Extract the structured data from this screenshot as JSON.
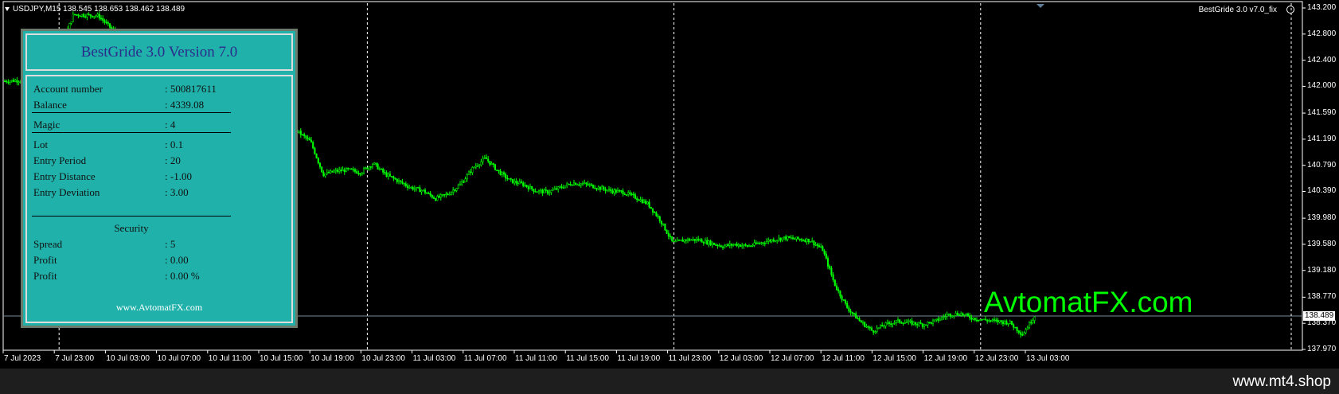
{
  "chart": {
    "symbol_line": "USDJPY,M15  138.545 138.653 138.462 138.489",
    "ea_label": "BestGride  3.0 v7.0_fix",
    "watermark": "AvtomatFX.com",
    "current_price": "138.489",
    "bull_color": "#00ff00",
    "bear_color": "#00ff00",
    "background": "#000000",
    "price_ticks": [
      "143.200",
      "142.800",
      "142.400",
      "142.000",
      "141.590",
      "141.190",
      "140.790",
      "140.390",
      "139.980",
      "139.580",
      "139.180",
      "138.770",
      "138.370",
      "137.970"
    ],
    "time_ticks": [
      "7 Jul 2023",
      "7 Jul 23:00",
      "10 Jul 03:00",
      "10 Jul 07:00",
      "10 Jul 11:00",
      "10 Jul 15:00",
      "10 Jul 19:00",
      "10 Jul 23:00",
      "11 Jul 03:00",
      "11 Jul 07:00",
      "11 Jul 11:00",
      "11 Jul 15:00",
      "11 Jul 19:00",
      "11 Jul 23:00",
      "12 Jul 03:00",
      "12 Jul 07:00",
      "12 Jul 11:00",
      "12 Jul 15:00",
      "12 Jul 19:00",
      "12 Jul 23:00",
      "13 Jul 03:00"
    ],
    "close_path": [
      [
        0,
        142.08
      ],
      [
        8,
        142.1
      ],
      [
        14,
        142.09
      ],
      [
        22,
        143.1
      ],
      [
        30,
        143.08
      ],
      [
        38,
        142.7
      ],
      [
        46,
        142.35
      ],
      [
        54,
        142.0
      ],
      [
        58,
        141.6
      ],
      [
        62,
        141.55
      ],
      [
        66,
        141.45
      ],
      [
        70,
        141.38
      ],
      [
        74,
        141.35
      ],
      [
        78,
        141.32
      ],
      [
        82,
        141.3
      ],
      [
        86,
        141.35
      ],
      [
        90,
        141.38
      ],
      [
        94,
        141.3
      ],
      [
        98,
        141.15
      ],
      [
        102,
        140.65
      ],
      [
        106,
        140.7
      ],
      [
        110,
        140.72
      ],
      [
        114,
        140.68
      ],
      [
        118,
        140.82
      ],
      [
        122,
        140.65
      ],
      [
        126,
        140.55
      ],
      [
        130,
        140.45
      ],
      [
        134,
        140.4
      ],
      [
        138,
        140.28
      ],
      [
        142,
        140.35
      ],
      [
        146,
        140.5
      ],
      [
        150,
        140.75
      ],
      [
        154,
        140.9
      ],
      [
        158,
        140.7
      ],
      [
        162,
        140.55
      ],
      [
        166,
        140.5
      ],
      [
        170,
        140.4
      ],
      [
        174,
        140.38
      ],
      [
        178,
        140.45
      ],
      [
        182,
        140.52
      ],
      [
        186,
        140.5
      ],
      [
        190,
        140.45
      ],
      [
        194,
        140.4
      ],
      [
        198,
        140.38
      ],
      [
        202,
        140.3
      ],
      [
        206,
        140.2
      ],
      [
        210,
        139.95
      ],
      [
        214,
        139.6
      ],
      [
        218,
        139.65
      ],
      [
        222,
        139.65
      ],
      [
        226,
        139.6
      ],
      [
        230,
        139.55
      ],
      [
        234,
        139.58
      ],
      [
        238,
        139.55
      ],
      [
        242,
        139.6
      ],
      [
        246,
        139.65
      ],
      [
        250,
        139.68
      ],
      [
        254,
        139.66
      ],
      [
        258,
        139.64
      ],
      [
        262,
        139.5
      ],
      [
        266,
        138.95
      ],
      [
        270,
        138.6
      ],
      [
        274,
        138.4
      ],
      [
        278,
        138.25
      ],
      [
        282,
        138.35
      ],
      [
        286,
        138.4
      ],
      [
        290,
        138.38
      ],
      [
        294,
        138.35
      ],
      [
        298,
        138.4
      ],
      [
        302,
        138.5
      ],
      [
        306,
        138.52
      ],
      [
        310,
        138.45
      ],
      [
        314,
        138.42
      ],
      [
        318,
        138.4
      ],
      [
        322,
        138.38
      ],
      [
        326,
        138.2
      ],
      [
        330,
        138.49
      ]
    ]
  },
  "panel": {
    "title": "BestGride 3.0 Version 7.0",
    "account_number": {
      "label": "Account number",
      "value": ": 500817611"
    },
    "balance": {
      "label": "Balance",
      "value": ": 4339.08"
    },
    "magic": {
      "label": "Magic",
      "value": ": 4"
    },
    "lot": {
      "label": "Lot",
      "value": ": 0.1"
    },
    "entry_period": {
      "label": "Entry Period",
      "value": ": 20"
    },
    "entry_distance": {
      "label": "Entry Distance",
      "value": ": -1.00"
    },
    "entry_deviation": {
      "label": "Entry Deviation",
      "value": ": 3.00"
    },
    "security_heading": "Security",
    "spread": {
      "label": "Spread",
      "value": ": 5"
    },
    "profit": {
      "label": "Profit",
      "value": ": 0.00"
    },
    "profit_pct": {
      "label": "Profit",
      "value": ": 0.00  %"
    },
    "website": "www.AvtomatFX.com"
  },
  "footer": {
    "site": "www.mt4.shop"
  }
}
